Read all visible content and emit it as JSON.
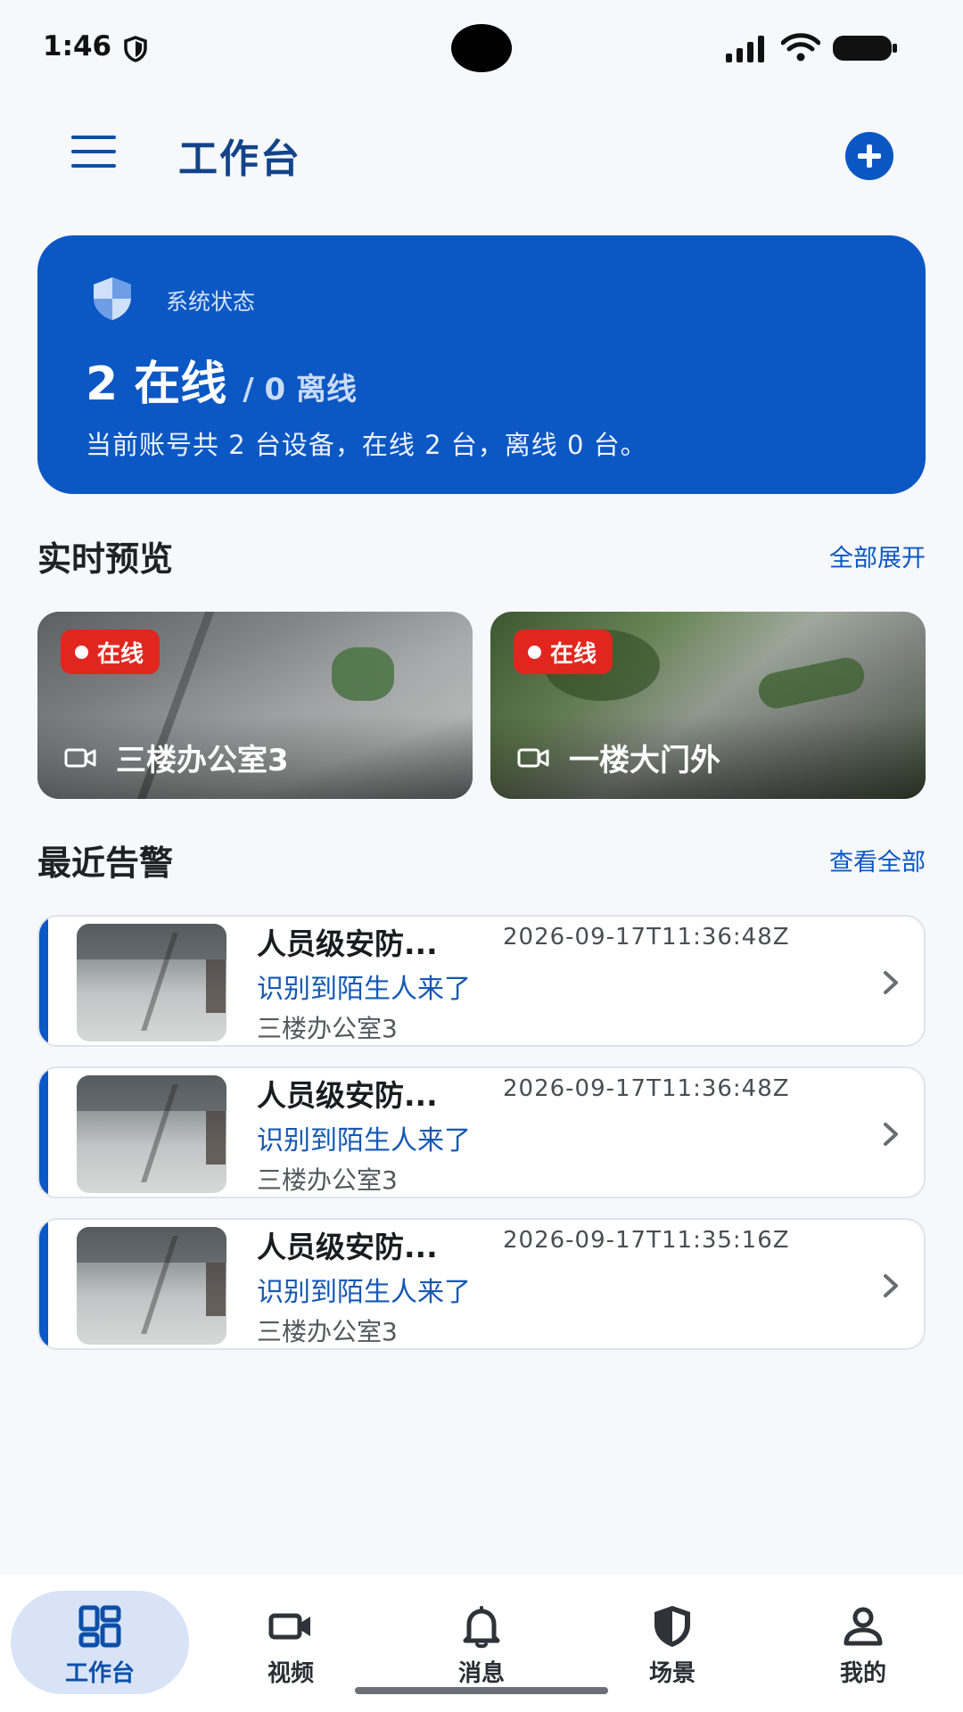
{
  "status_bar": {
    "time": "1:46"
  },
  "app_bar": {
    "title": "工作台"
  },
  "system_card": {
    "label": "系统状态",
    "online": "2 在线",
    "offline": "/ 0 离线",
    "description": "当前账号共 2 台设备，在线 2 台，离线 0 台。"
  },
  "preview": {
    "title": "实时预览",
    "expand_label": "全部展开",
    "cameras": [
      {
        "status": "在线",
        "name": "三楼办公室3"
      },
      {
        "status": "在线",
        "name": "一楼大门外"
      }
    ]
  },
  "alerts": {
    "title": "最近告警",
    "view_all_label": "查看全部",
    "items": [
      {
        "title": "人员级安防...",
        "time": "2026-09-17T11:36:48Z",
        "description": "识别到陌生人来了",
        "location": "三楼办公室3"
      },
      {
        "title": "人员级安防...",
        "time": "2026-09-17T11:36:48Z",
        "description": "识别到陌生人来了",
        "location": "三楼办公室3"
      },
      {
        "title": "人员级安防...",
        "time": "2026-09-17T11:35:16Z",
        "description": "识别到陌生人来了",
        "location": "三楼办公室3"
      }
    ]
  },
  "bottom_nav": {
    "items": [
      {
        "label": "工作台",
        "icon": "dashboard-icon",
        "active": true
      },
      {
        "label": "视频",
        "icon": "video-camera-icon",
        "active": false
      },
      {
        "label": "消息",
        "icon": "bell-icon",
        "active": false
      },
      {
        "label": "场景",
        "icon": "shield-icon",
        "active": false
      },
      {
        "label": "我的",
        "icon": "person-icon",
        "active": false
      }
    ]
  },
  "colors": {
    "primary": "#0b57c4",
    "title_blue": "#13448a",
    "badge_red": "#e0261f",
    "nav_active_bg": "#d8e3f8",
    "background": "#f6f8fc"
  }
}
